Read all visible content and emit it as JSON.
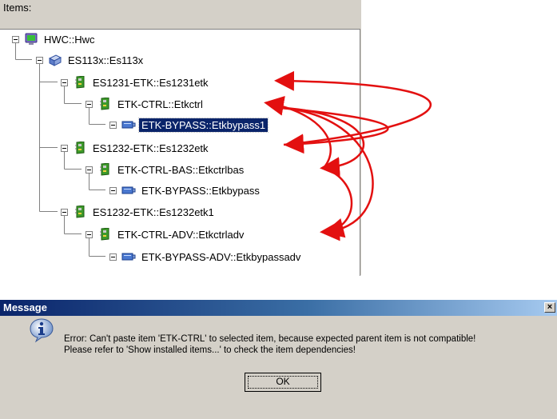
{
  "panel": {
    "label": "Items:"
  },
  "tree": [
    {
      "label": "HWC::Hwc",
      "icon": "hwc-monitor-icon"
    },
    {
      "label": "ES113x::Es113x",
      "icon": "device-module-icon"
    },
    {
      "label": "ES1231-ETK::Es1231etk",
      "icon": "circuit-board-icon"
    },
    {
      "label": "ETK-CTRL::Etkctrl",
      "icon": "circuit-board-icon"
    },
    {
      "label": "ETK-BYPASS::Etkbypass1",
      "icon": "bypass-plug-icon",
      "selected": true
    },
    {
      "label": "ES1232-ETK::Es1232etk",
      "icon": "circuit-board-icon"
    },
    {
      "label": "ETK-CTRL-BAS::Etkctrlbas",
      "icon": "circuit-board-icon"
    },
    {
      "label": "ETK-BYPASS::Etkbypass",
      "icon": "bypass-plug-icon"
    },
    {
      "label": "ES1232-ETK::Es1232etk1",
      "icon": "circuit-board-icon"
    },
    {
      "label": "ETK-CTRL-ADV::Etkctrladv",
      "icon": "circuit-board-icon"
    },
    {
      "label": "ETK-BYPASS-ADV::Etkbypassadv",
      "icon": "bypass-plug-icon"
    }
  ],
  "dialog": {
    "title": "Message",
    "close_label": "×",
    "message_line1": "Error: Can't paste item 'ETK-CTRL' to selected item, because expected parent item is not compatible!",
    "message_line2": "Please refer to 'Show installed items...' to check the item dependencies!",
    "ok_label": "OK"
  },
  "colors": {
    "selection": "#0a246a",
    "arrow": "#e31010",
    "board_green": "#3d9a2a",
    "dialog_face": "#d4d0c8"
  }
}
